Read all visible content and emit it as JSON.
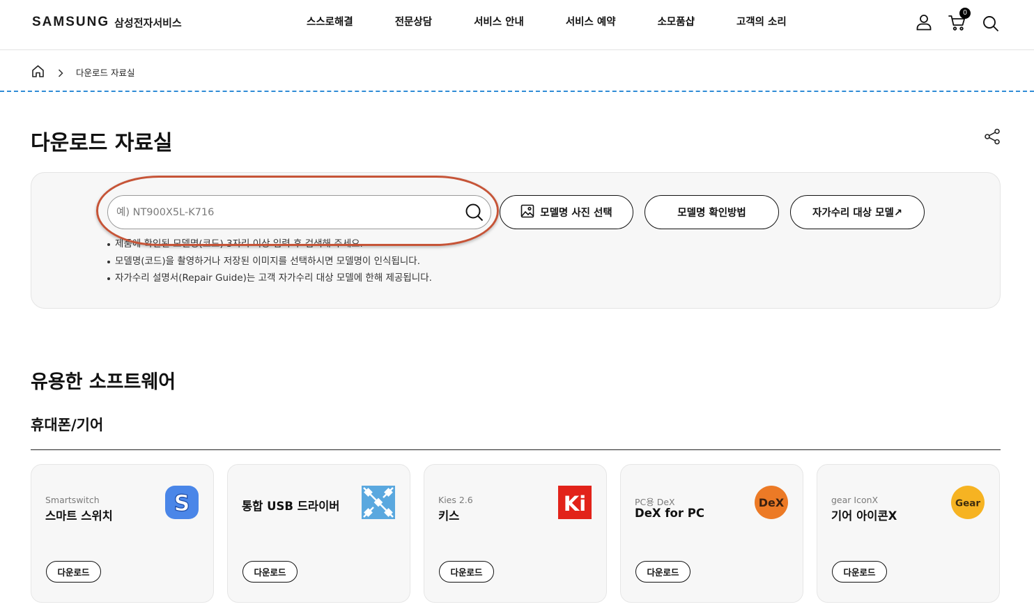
{
  "header": {
    "logo": {
      "wordmark": "SAMSUNG",
      "service": "삼성전자서비스"
    },
    "nav": [
      "스스로해결",
      "전문상담",
      "서비스 안내",
      "서비스 예약",
      "소모품샵",
      "고객의 소리"
    ],
    "cart_count": "0",
    "icons": [
      "user-icon",
      "cart-icon",
      "search-icon"
    ]
  },
  "breadcrumb": {
    "home_icon": "home-icon",
    "current": "다운로드 자료실"
  },
  "page": {
    "title": "다운로드 자료실",
    "share_icon": "share-icon"
  },
  "search": {
    "value": "",
    "placeholder": "예) NT900X5L-K716",
    "icon": "search-icon",
    "buttons": [
      {
        "label": "모델명 사진 선택",
        "icon": "image-icon"
      },
      {
        "label": "모델명 확인방법"
      },
      {
        "label": "자가수리 대상 모델↗"
      }
    ],
    "notes": [
      "제품에 확인된 모델명(코드) 3자리 이상 입력 후 검색해 주세요.",
      "모델명(코드)을 촬영하거나 저장된 이미지를 선택하시면 모델명이 인식됩니다.",
      "자가수리 설명서(Repair Guide)는 고객 자가수리 대상 모델에 한해 제공됩니다."
    ]
  },
  "software": {
    "title": "유용한 소프트웨어",
    "category": "휴대폰/기어",
    "cards": [
      {
        "label": "Smartswitch",
        "title": "스마트 스위치",
        "button": "다운로드",
        "icon": "smart-switch-icon",
        "logo_text": "S",
        "color": "#4a86e8"
      },
      {
        "title": "통합 USB 드라이버",
        "button": "다운로드",
        "icon": "usb-driver-icon",
        "color": "#5aa8df"
      },
      {
        "label": "Kies 2.6",
        "title": "키스",
        "button": "다운로드",
        "icon": "kies-icon",
        "logo_text": "Ki",
        "color": "#e2231a"
      },
      {
        "label": "PC용 DeX",
        "title": "DeX for PC",
        "button": "다운로드",
        "icon": "dex-icon",
        "logo_text": "DeX",
        "color": "#ec7a26"
      },
      {
        "label": "gear IconX",
        "title": "기어 아이콘X",
        "button": "다운로드",
        "icon": "gear-iconx-icon",
        "logo_text": "Gear",
        "color": "#f6b322"
      }
    ]
  },
  "colors": {
    "dashed_divider": "#2f8bd6",
    "annotation": "#c65437",
    "panel_bg": "#f7f7f7",
    "text": "#111111"
  }
}
